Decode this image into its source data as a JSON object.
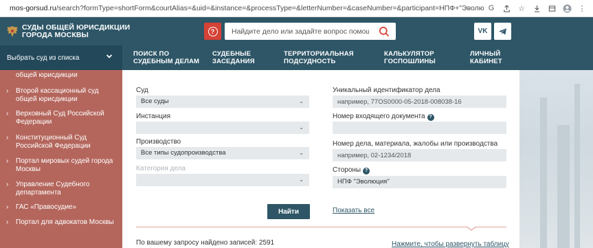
{
  "browser": {
    "url_domain": "mos-gorsud.ru",
    "url_path": "/search?formType=shortForm&courtAlias=&uid=&instance=&processType=&letterNumber=&caseNumber=&participant=НПФ+\"Эволюция\""
  },
  "header": {
    "logo_line1": "СУДЫ ОБЩЕЙ ЮРИСДИКЦИИ",
    "logo_line2": "ГОРОДА МОСКВЫ",
    "search_placeholder": "Найдите дело или задайте вопрос помощнику",
    "vk_label": "VK"
  },
  "nav": {
    "court_select": "Выбрать суд из списка",
    "items": [
      {
        "line1": "ПОИСК ПО",
        "line2": "СУДЕБНЫМ ДЕЛАМ"
      },
      {
        "line1": "СУДЕБНЫЕ",
        "line2": "ЗАСЕДАНИЯ"
      },
      {
        "line1": "ТЕРРИТОРИАЛЬНАЯ",
        "line2": "ПОДСУДНОСТЬ"
      },
      {
        "line1": "КАЛЬКУЛЯТОР",
        "line2": "ГОСПОШЛИНЫ"
      },
      {
        "line1": "ЛИЧНЫЙ",
        "line2": "КАБИНЕТ"
      }
    ]
  },
  "sidebar": {
    "partial_item": "общей юрисдикции",
    "items": [
      {
        "line1": "Второй кассационный суд",
        "line2": "общей юрисдикции"
      },
      {
        "line1": "Верховный Суд Российской",
        "line2": "Федерации"
      },
      {
        "line1": "Конституционный Суд",
        "line2": "Российской Федерации"
      },
      {
        "line1": "Портал мировых судей города",
        "line2": "Москвы"
      },
      {
        "line1": "Управление Судебного",
        "line2": "департамента"
      },
      {
        "line1": "ГАС «Правосудие»",
        "line2": ""
      },
      {
        "line1": "Портал для адвокатов Москвы",
        "line2": ""
      }
    ]
  },
  "form": {
    "court_label": "Суд",
    "court_value": "Все суды",
    "instance_label": "Инстанция",
    "instance_value": "",
    "proceeding_label": "Производство",
    "proceeding_value": "Все типы судопроизводства",
    "category_label": "Категория дела",
    "category_value": "",
    "uid_label": "Уникальный идентификатор дела",
    "uid_placeholder": "например, 77OS0000-05-2018-008038-16",
    "incoming_label": "Номер входящего документа",
    "incoming_placeholder": "",
    "case_number_label": "Номер дела, материала, жалобы или производства",
    "case_number_placeholder": "например, 02-1234/2018",
    "parties_label": "Стороны",
    "parties_value": "НПФ \"Эволюция\"",
    "info_glyph": "?"
  },
  "actions": {
    "find_button": "Найти",
    "show_all": "Показать все"
  },
  "results": {
    "found_text": "По вашему запросу найдено записей: 2591",
    "expand_link": "Нажмите, чтобы развернуть таблицу"
  },
  "colors": {
    "header_bg": "#2e5667",
    "sidebar_bg": "#b4665c",
    "accent_red": "#d64236",
    "field_bg": "#e5e9ec"
  }
}
